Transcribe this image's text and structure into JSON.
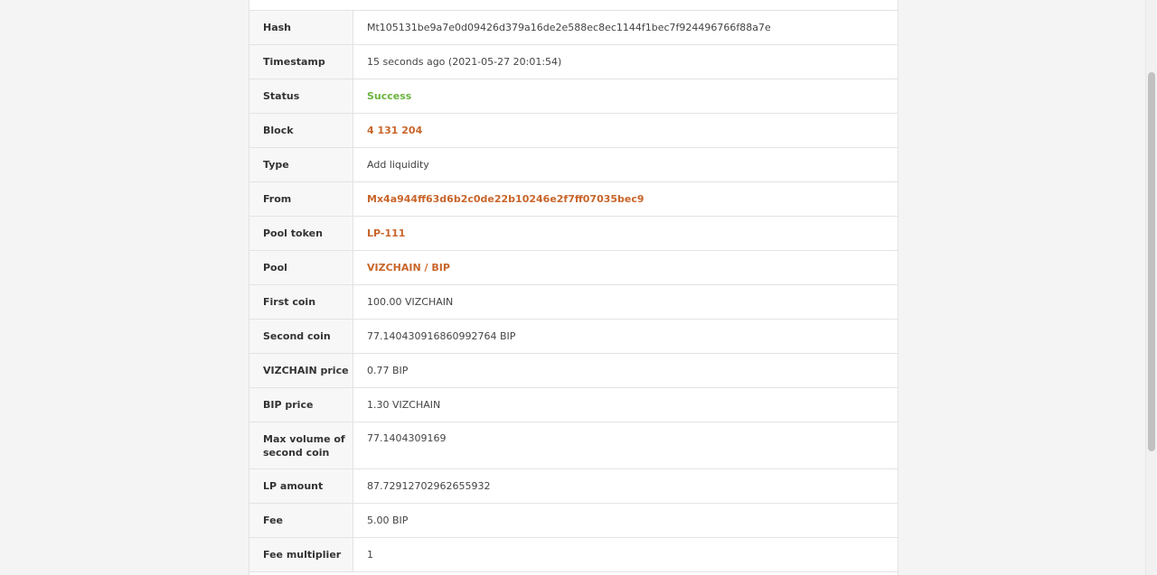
{
  "rows": [
    {
      "label": "Hash",
      "value": "Mt105131be9a7e0d09426d379a16de2e588ec8ec1144f1bec7f924496766f88a7e",
      "style": "plain"
    },
    {
      "label": "Timestamp",
      "value": "15 seconds ago (2021-05-27 20:01:54)",
      "style": "plain"
    },
    {
      "label": "Status",
      "value": "Success",
      "style": "success"
    },
    {
      "label": "Block",
      "value": "4 131 204",
      "style": "link"
    },
    {
      "label": "Type",
      "value": "Add liquidity",
      "style": "plain"
    },
    {
      "label": "From",
      "value": "Mx4a944ff63d6b2c0de22b10246e2f7ff07035bec9",
      "style": "link"
    },
    {
      "label": "Pool token",
      "value": "LP-111",
      "style": "link"
    },
    {
      "label": "Pool",
      "value": "VIZCHAIN / BIP",
      "style": "link"
    },
    {
      "label": "First coin",
      "value": "100.00 VIZCHAIN",
      "style": "plain"
    },
    {
      "label": "Second coin",
      "value": "77.140430916860992764 BIP",
      "style": "plain"
    },
    {
      "label": "VIZCHAIN price",
      "value": "0.77 BIP",
      "style": "plain"
    },
    {
      "label": "BIP price",
      "value": "1.30 VIZCHAIN",
      "style": "plain"
    },
    {
      "label": "Max volume of second coin",
      "value": "77.1404309169",
      "style": "plain"
    },
    {
      "label": "LP amount",
      "value": "87.72912702962655932",
      "style": "plain"
    },
    {
      "label": "Fee",
      "value": "5.00 BIP",
      "style": "plain"
    },
    {
      "label": "Fee multiplier",
      "value": "1",
      "style": "plain"
    }
  ],
  "colors": {
    "success": "#6bb33e",
    "link": "#c9652a"
  }
}
